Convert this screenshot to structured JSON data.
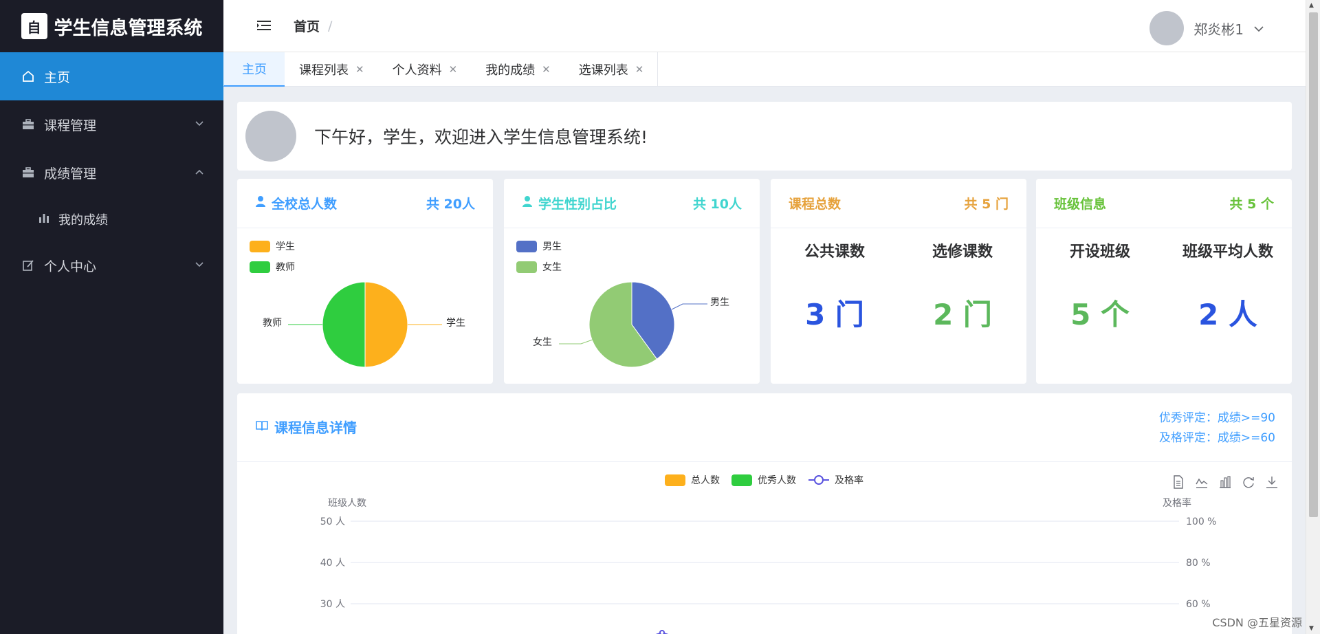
{
  "app": {
    "title": "学生信息管理系统",
    "logo_glyph": "自"
  },
  "sidebar": {
    "items": [
      {
        "label": "主页",
        "icon": "home-icon",
        "active": true
      },
      {
        "label": "课程管理",
        "icon": "briefcase-icon",
        "expandable": true,
        "expanded": false
      },
      {
        "label": "成绩管理",
        "icon": "briefcase-icon",
        "expandable": true,
        "expanded": true,
        "children": [
          {
            "label": "我的成绩",
            "icon": "bar-chart-icon"
          }
        ]
      },
      {
        "label": "个人中心",
        "icon": "edit-icon",
        "expandable": true,
        "expanded": false
      }
    ]
  },
  "header": {
    "breadcrumb": "首页",
    "breadcrumb_sep": "/",
    "user_name": "郑炎彬1"
  },
  "tabs": [
    {
      "label": "主页",
      "active": true,
      "closable": false
    },
    {
      "label": "课程列表",
      "active": false,
      "closable": true
    },
    {
      "label": "个人资料",
      "active": false,
      "closable": true
    },
    {
      "label": "我的成绩",
      "active": false,
      "closable": true
    },
    {
      "label": "选课列表",
      "active": false,
      "closable": true
    }
  ],
  "welcome": {
    "text": "下午好，学生，欢迎进入学生信息管理系统!"
  },
  "cards": {
    "total": {
      "title": "全校总人数",
      "count": "共 20人",
      "color": "#409eff",
      "legend": [
        "学生",
        "教师"
      ],
      "colors": [
        "#fdb01c",
        "#2fcd3f"
      ],
      "pie_labels": [
        "学生",
        "教师"
      ]
    },
    "gender": {
      "title": "学生性别占比",
      "count": "共 10人",
      "color": "#40d5cf",
      "legend": [
        "男生",
        "女生"
      ],
      "colors": [
        "#5370c6",
        "#92cb74"
      ],
      "pie_labels": [
        "男生",
        "女生"
      ]
    },
    "course": {
      "title": "课程总数",
      "count": "共 5 门",
      "color": "#e6a23c",
      "items": [
        {
          "label": "公共课数",
          "value": "3 门",
          "color": "#2a54df"
        },
        {
          "label": "选修课数",
          "value": "2 门",
          "color": "#5cb85c"
        }
      ]
    },
    "class": {
      "title": "班级信息",
      "count": "共 5 个",
      "color": "#67c23a",
      "items": [
        {
          "label": "开设班级",
          "value": "5 个",
          "color": "#5cb85c"
        },
        {
          "label": "班级平均人数",
          "value": "2 人",
          "color": "#2a54df"
        }
      ]
    }
  },
  "detail": {
    "title": "课程信息详情",
    "note_lines": [
      "优秀评定：成绩>=90",
      "及格评定：成绩>=60"
    ],
    "toolbox": [
      "data-view-icon",
      "line-switch-icon",
      "bar-switch-icon",
      "restore-icon",
      "download-icon"
    ]
  },
  "chart_data": [
    {
      "type": "pie",
      "categories": [
        "学生",
        "教师"
      ],
      "values": [
        10,
        10
      ],
      "colors": [
        "#fdb01c",
        "#2fcd3f"
      ]
    },
    {
      "type": "pie",
      "categories": [
        "男生",
        "女生"
      ],
      "values": [
        4,
        6
      ],
      "colors": [
        "#5370c6",
        "#92cb74"
      ]
    },
    {
      "type": "bar",
      "series": [
        {
          "name": "总人数",
          "color": "#fdb01c"
        },
        {
          "name": "优秀人数",
          "color": "#2fcd3f"
        },
        {
          "name": "及格率",
          "color": "#5a54df",
          "kind": "line"
        }
      ],
      "ylabel": "班级人数",
      "y2label": "及格率",
      "yticks": [
        "50 人",
        "40 人",
        "30 人"
      ],
      "y2ticks": [
        "100 %",
        "80 %",
        "60 %"
      ],
      "ylim": [
        0,
        50
      ],
      "y2lim": [
        0,
        100
      ],
      "legend": "top"
    }
  ],
  "watermark": "CSDN @五星资源"
}
